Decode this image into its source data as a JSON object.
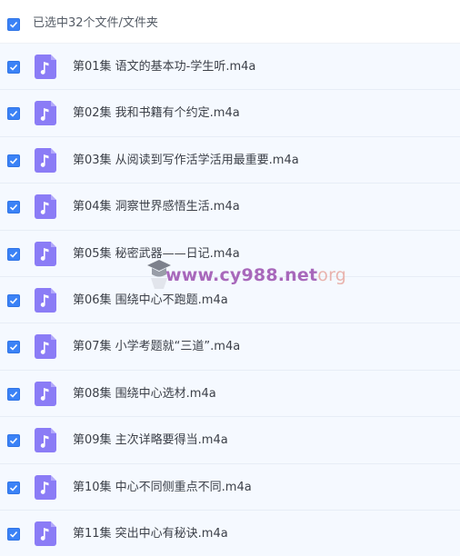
{
  "header": {
    "selected_label": "已选中32个文件/文件夹"
  },
  "files": [
    {
      "name": "第01集 语文的基本功-学生听.m4a"
    },
    {
      "name": "第02集 我和书籍有个约定.m4a"
    },
    {
      "name": "第03集 从阅读到写作活学活用最重要.m4a"
    },
    {
      "name": "第04集 洞察世界感悟生活.m4a"
    },
    {
      "name": "第05集 秘密武器——日记.m4a"
    },
    {
      "name": "第06集 围绕中心不跑题.m4a"
    },
    {
      "name": "第07集 小学考题就“三道”.m4a"
    },
    {
      "name": "第08集 围绕中心选材.m4a"
    },
    {
      "name": "第09集 主次详略要得当.m4a"
    },
    {
      "name": "第10集 中心不同侧重点不同.m4a"
    },
    {
      "name": "第11集 突出中心有秘诀.m4a"
    }
  ],
  "watermark": {
    "main": "www.cy988.net",
    "tld": "org"
  },
  "colors": {
    "checkbox": "#3b82f6",
    "file_icon": "#8b7cf6",
    "row_background": "#f5f9ff"
  },
  "icons": {
    "checkbox": "check-icon",
    "file": "music-note-icon"
  }
}
